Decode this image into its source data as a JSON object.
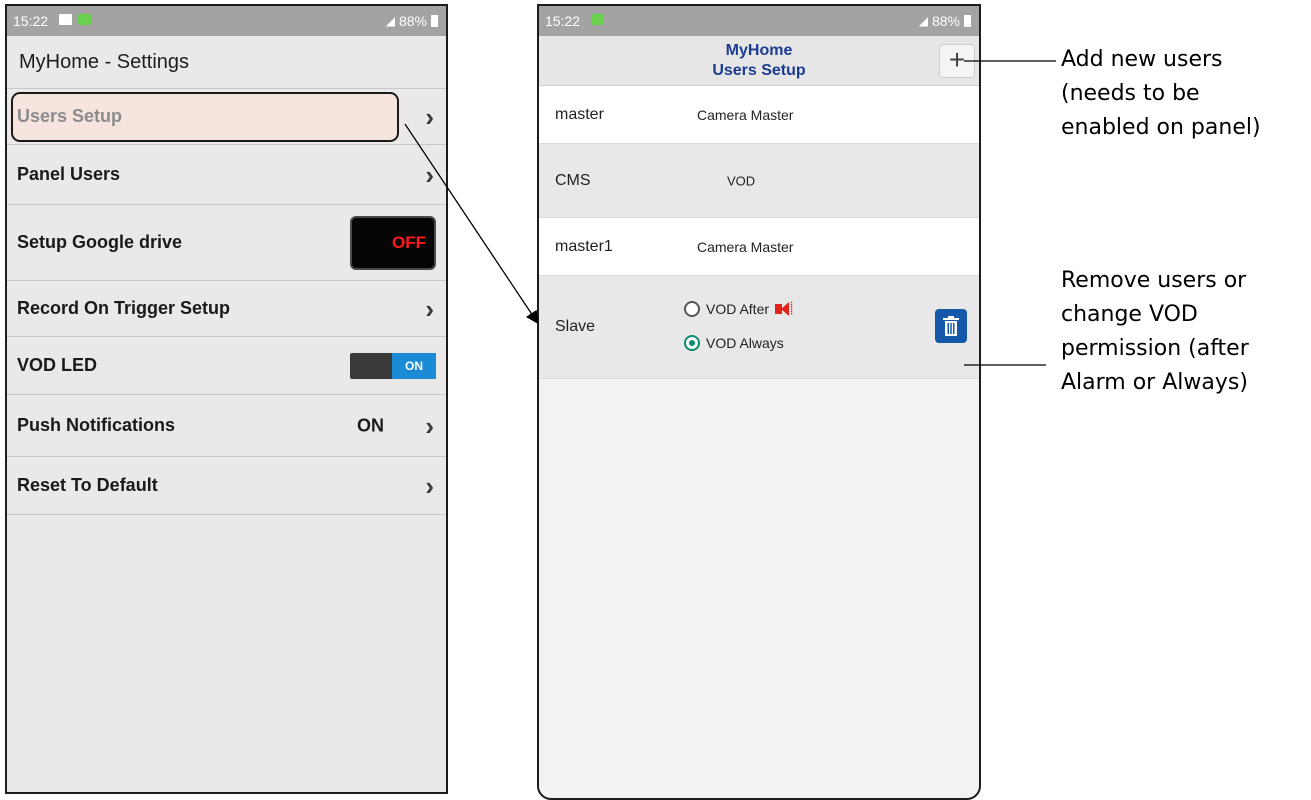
{
  "left_screen": {
    "status_bar": {
      "time": "15:22",
      "signal_battery": "88%"
    },
    "title": "MyHome - Settings",
    "items": [
      {
        "label": "Users Setup"
      },
      {
        "label": "Panel Users"
      },
      {
        "label": "Setup Google drive",
        "toggle": "OFF"
      },
      {
        "label": "Record On Trigger Setup"
      },
      {
        "label": "VOD LED",
        "toggle": "ON"
      },
      {
        "label": "Push Notifications",
        "value": "ON"
      },
      {
        "label": "Reset To Default"
      }
    ]
  },
  "right_screen": {
    "status_bar": {
      "time": "15:22",
      "signal_battery": "88%"
    },
    "header": {
      "line1": "MyHome",
      "line2": "Users Setup",
      "add_button": "+"
    },
    "users": [
      {
        "name": "master",
        "role": "Camera Master"
      },
      {
        "name": "CMS",
        "role": "VOD"
      },
      {
        "name": "master1",
        "role": "Camera Master"
      },
      {
        "name": "Slave",
        "options": [
          "VOD After",
          "VOD Always"
        ],
        "selected": "VOD Always"
      }
    ]
  },
  "annotations": {
    "add_users": [
      "Add new users",
      "(needs to be",
      "enabled on panel)"
    ],
    "remove_users": [
      "Remove users or",
      "change VOD",
      "permission (after",
      "Alarm or Always)"
    ]
  },
  "colors": {
    "header_title": "#1c3c92",
    "toggle_off_text": "#ff1a1a",
    "toggle_on": "#1b8bd6",
    "radio_selected": "#0c8a6e",
    "trash_button": "#1558a8",
    "alarm_icon": "#e3221b"
  }
}
